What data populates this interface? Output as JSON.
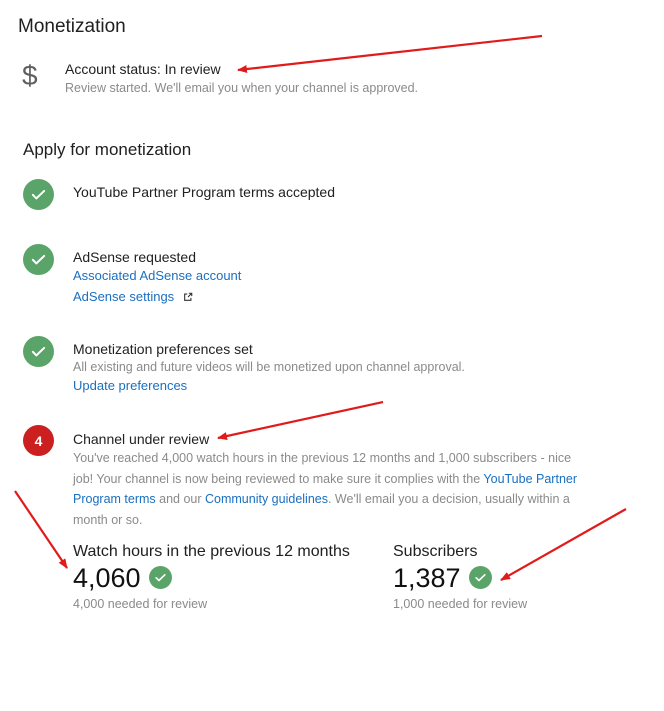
{
  "header": {
    "title": "Monetization"
  },
  "account_status": {
    "icon": "dollar-icon",
    "title": "Account status: In review",
    "subtitle": "Review started. We'll email you when your channel is approved."
  },
  "apply": {
    "title": "Apply for monetization",
    "steps": [
      {
        "icon": "check-circle-icon",
        "title": "YouTube Partner Program terms accepted"
      },
      {
        "icon": "check-circle-icon",
        "title": "AdSense requested",
        "link1": "Associated AdSense account",
        "link2": "AdSense settings",
        "link2_icon": "external-link-icon"
      },
      {
        "icon": "check-circle-icon",
        "title": "Monetization preferences set",
        "desc": "All existing and future videos will be monetized upon channel approval.",
        "link": "Update preferences"
      },
      {
        "icon_text": "4",
        "title": "Channel under review",
        "desc_part1": "You've reached 4,000 watch hours in the previous 12 months and 1,000 subscribers - nice job! Your channel is now being reviewed to make sure it complies with the ",
        "desc_link1": "YouTube Partner Program terms",
        "desc_part2": " and our ",
        "desc_link2": "Community guidelines",
        "desc_part3": ". We'll email you a decision, usually within a month or so."
      }
    ]
  },
  "stats": {
    "watch_hours": {
      "label": "Watch hours in the previous 12 months",
      "value": "4,060",
      "note": "4,000 needed for review"
    },
    "subscribers": {
      "label": "Subscribers",
      "value": "1,387",
      "note": "1,000 needed for review"
    }
  },
  "colors": {
    "check_green": "#5aa469",
    "step_red": "#cc1f1f",
    "link_blue": "#1a6fc0",
    "arrow_red": "#e11b1b"
  }
}
